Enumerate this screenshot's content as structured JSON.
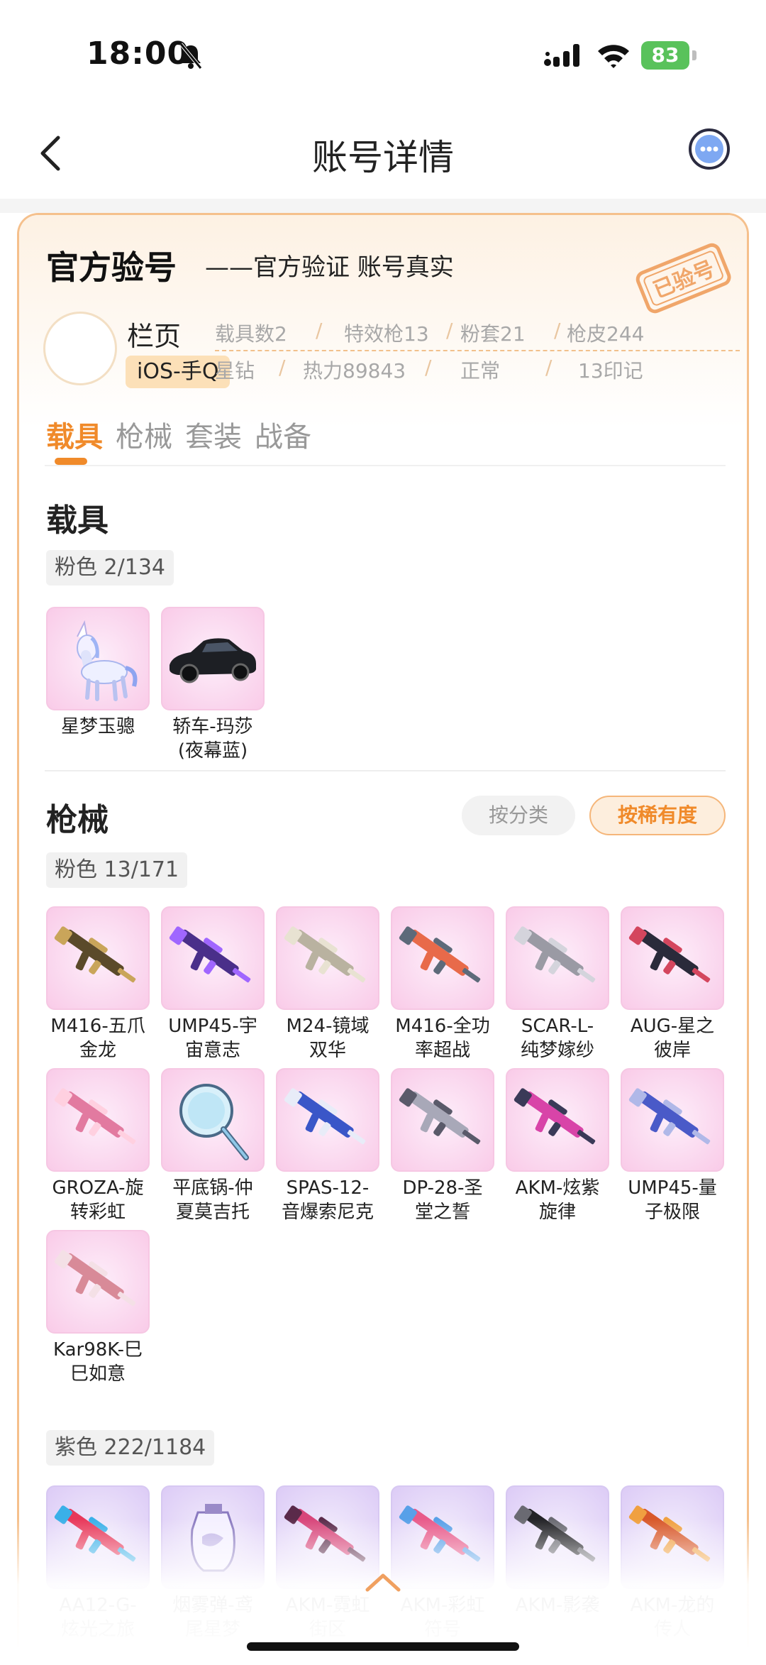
{
  "status_bar": {
    "time": "18:00",
    "battery": "83"
  },
  "nav": {
    "title": "账号详情"
  },
  "header": {
    "title": "官方验号",
    "subtitle": "——官方验证 账号真实",
    "stamp_text": "已验号",
    "account_name": "栏页",
    "platform": "iOS-手Q",
    "stats_row1": [
      "载具数2",
      "特效枪13",
      "粉套21",
      "枪皮244"
    ],
    "stats_row2": [
      "星钻",
      "热力89843",
      "正常",
      "13印记"
    ]
  },
  "tabs": [
    "载具",
    "枪械",
    "套装",
    "战备"
  ],
  "vehicles": {
    "title": "载具",
    "chip": "粉色 2/134",
    "items": [
      "星梦玉骢",
      "轿车-玛莎\n(夜幕蓝)"
    ]
  },
  "guns": {
    "title": "枪械",
    "sort_category": "按分类",
    "sort_rarity": "按稀有度",
    "pink_chip": "粉色 13/171",
    "pink_items": [
      "M416-五爪\n金龙",
      "UMP45-宇\n宙意志",
      "M24-镜域\n双华",
      "M416-全功\n率超战",
      "SCAR-L-\n纯梦嫁纱",
      "AUG-星之\n彼岸",
      "GROZA-旋\n转彩虹",
      "平底锅-仲\n夏莫吉托",
      "SPAS-12-\n音爆索尼克",
      "DP-28-圣\n堂之誓",
      "AKM-炫紫\n旋律",
      "UMP45-量\n子极限",
      "Kar98K-巳\n巳如意"
    ],
    "purple_chip": "紫色 222/1184",
    "purple_items": [
      "AA12-G-\n炫光之旅",
      "烟雾弹-鸢\n尾星梦",
      "AKM-霓虹\n街区",
      "AKM-彩虹\n符号",
      "AKM-影袭",
      "AKM-龙的\n传人"
    ]
  },
  "colors": {
    "accent": "#f08a2a",
    "pink_bg": "#f9cbe8",
    "purple_bg": "#dccbf6",
    "border": "#f5c08c"
  }
}
